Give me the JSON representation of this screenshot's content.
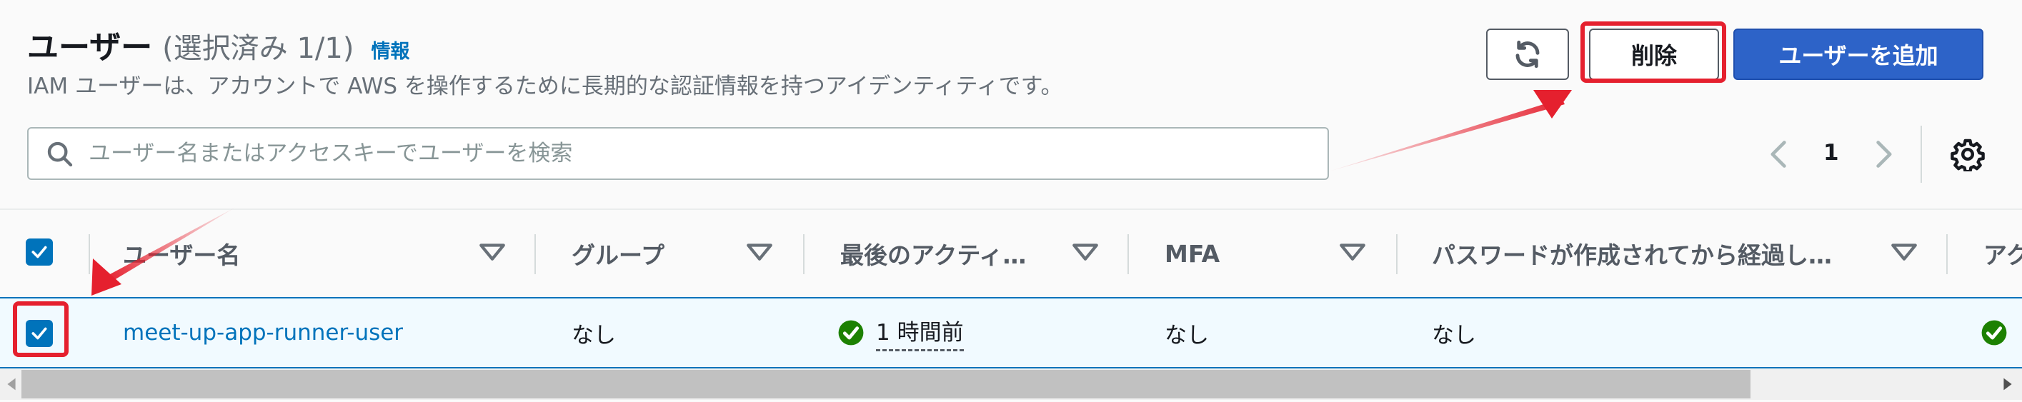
{
  "header": {
    "title": "ユーザー",
    "selection_count": "(選択済み 1/1)",
    "info_link": "情報",
    "description": "IAM ユーザーは、アカウントで AWS を操作するために長期的な認証情報を持つアイデンティティです。"
  },
  "actions": {
    "refresh_icon": "refresh-icon",
    "delete_label": "削除",
    "add_label": "ユーザーを追加"
  },
  "search": {
    "placeholder": "ユーザー名またはアクセスキーでユーザーを検索",
    "value": ""
  },
  "pagination": {
    "current_page": "1"
  },
  "table": {
    "columns": [
      "ユーザー名",
      "グループ",
      "最後のアクティ…",
      "MFA",
      "パスワードが作成されてから経過し…",
      "アク"
    ],
    "rows": [
      {
        "selected": true,
        "user_name": "meet-up-app-runner-user",
        "groups": "なし",
        "last_activity": "1 時間前",
        "mfa": "なし",
        "password_age": "なし"
      }
    ]
  },
  "colors": {
    "accent": "#0073bb",
    "primary_button": "#2d63c8",
    "annotation": "#e5202e",
    "success": "#1d8102"
  }
}
